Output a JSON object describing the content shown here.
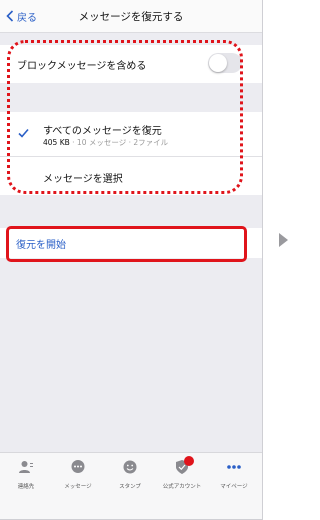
{
  "header": {
    "back_label": "戻る",
    "title": "メッセージを復元する"
  },
  "settings": {
    "include_blocked_label": "ブロックメッセージを含める",
    "include_blocked_on": false
  },
  "options": {
    "all_title": "すべてのメッセージを復元",
    "all_size": "405 KB",
    "all_detail": " · 10 メッセージ · 2ファイル",
    "select_label": "メッセージを選択"
  },
  "action": {
    "start_label": "復元を開始"
  },
  "tabs": [
    {
      "label": "連絡先",
      "icon": "person-icon"
    },
    {
      "label": "メッセージ",
      "icon": "chat-bubble-icon"
    },
    {
      "label": "スタンプ",
      "icon": "smiley-icon"
    },
    {
      "label": "公式アカウント",
      "icon": "shield-check-icon"
    },
    {
      "label": "マイページ",
      "icon": "more-dots-icon"
    }
  ],
  "colors": {
    "accent": "#2a5fc7",
    "annotation": "#e0141b",
    "background": "#ececf1"
  }
}
